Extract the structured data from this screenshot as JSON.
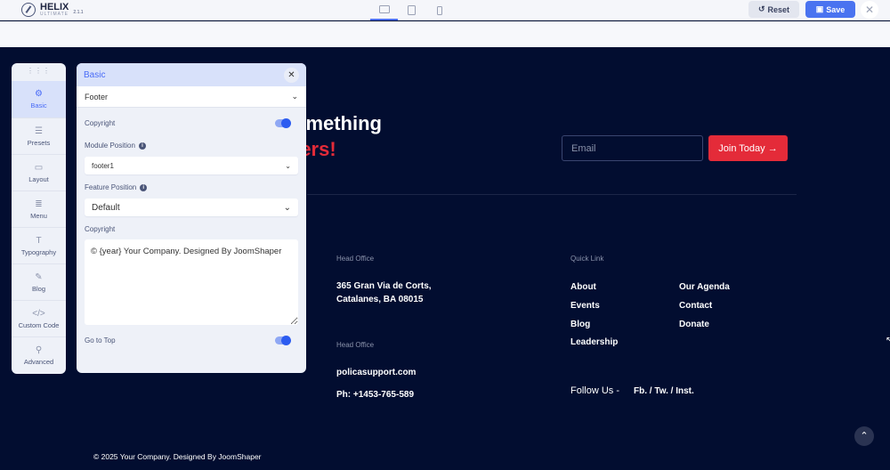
{
  "app": {
    "name": "HELIX",
    "subtitle": "ULTIMATE",
    "version": "2.1.1"
  },
  "toolbar": {
    "devices": [
      "desktop",
      "tablet",
      "mobile"
    ],
    "active_device": "desktop",
    "reset_label": "Reset",
    "save_label": "Save"
  },
  "sidebar": {
    "items": [
      {
        "label": "Basic",
        "icon": "⚙",
        "active": true
      },
      {
        "label": "Presets",
        "icon": "☰"
      },
      {
        "label": "Layout",
        "icon": "▭"
      },
      {
        "label": "Menu",
        "icon": "≣"
      },
      {
        "label": "Typography",
        "icon": "T"
      },
      {
        "label": "Blog",
        "icon": "✎"
      },
      {
        "label": "Custom Code",
        "icon": "</>"
      },
      {
        "label": "Advanced",
        "icon": "⚲"
      }
    ]
  },
  "panel": {
    "title": "Basic",
    "section": "Footer",
    "copyright_toggle_label": "Copyright",
    "copyright_enabled": true,
    "module_position_label": "Module Position",
    "module_position_value": "footer1",
    "feature_position_label": "Feature Position",
    "feature_position_value": "Default",
    "copyright_text_label": "Copyright",
    "copyright_text": "© {year} Your Company. Designed By JoomShaper",
    "go_to_top_label": "Go to Top",
    "go_to_top_enabled": true
  },
  "site": {
    "headline_1": "omething",
    "headline_2": "ters!",
    "email_placeholder": "Email",
    "join_label": "Join Today →",
    "head_office_label_1": "Head Office",
    "address_1": "365 Gran Via de Corts,",
    "address_2": "Catalanes, BA 08015",
    "head_office_label_2": "Head Office",
    "email": "policasupport.com",
    "phone": "Ph: +1453-765-589",
    "quick_link_label": "Quick Link",
    "links_col1": [
      "About",
      "Events",
      "Blog",
      "Leadership"
    ],
    "links_col2": [
      "Our Agenda",
      "Contact",
      "Donate"
    ],
    "follow_label": "Follow Us -",
    "social": "Fb. / Tw. / Inst.",
    "copyright": "© 2025 Your Company. Designed By JoomShaper"
  },
  "colors": {
    "accent": "#4a6cf7",
    "brand_red": "#e42b39",
    "footer_bg": "#020d30"
  }
}
